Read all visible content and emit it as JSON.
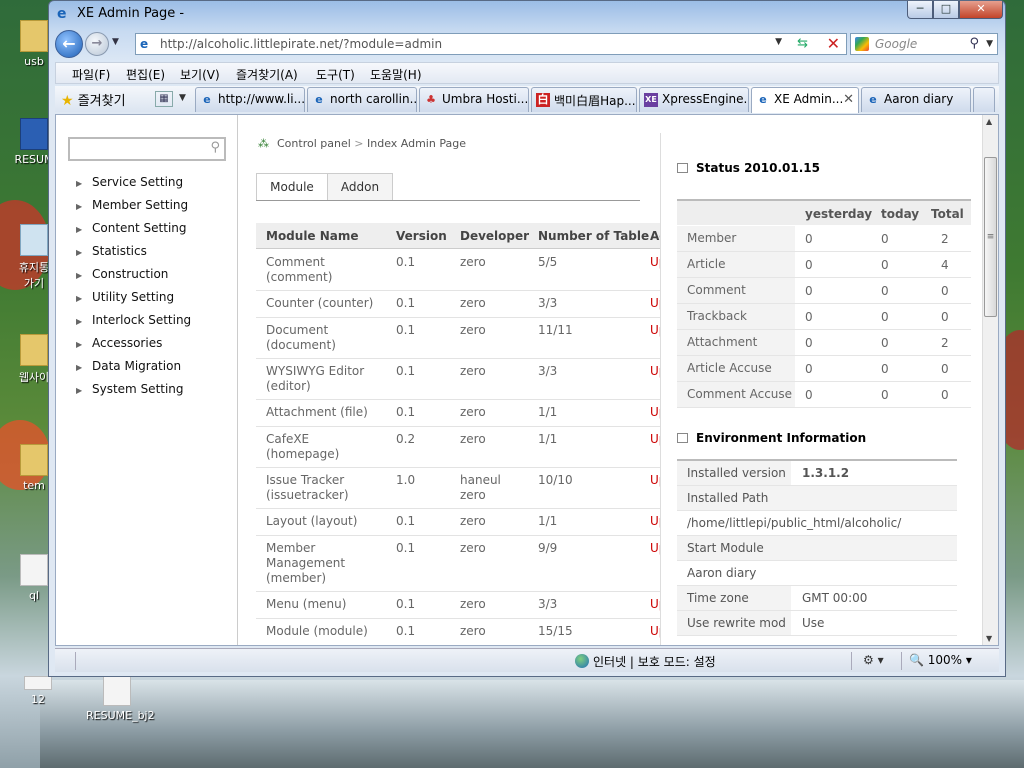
{
  "desktop": {
    "icons": [
      {
        "label": "usb",
        "icon": "folder-icon"
      },
      {
        "label": "RESUM",
        "icon": "word-doc-icon"
      },
      {
        "label": "휴지통\n가기",
        "icon": "recycle-bin-icon"
      },
      {
        "label": "웹사이",
        "icon": "folder-icon"
      },
      {
        "label": "tem",
        "icon": "folder-icon"
      },
      {
        "label": "ql",
        "icon": "file-icon"
      },
      {
        "label": "12",
        "icon": "file-icon"
      },
      {
        "label": "RESUME_bj2",
        "icon": "document-icon"
      }
    ]
  },
  "window": {
    "title": "XE Admin Page -",
    "controls": {
      "minimize": "─",
      "maximize": "□",
      "close": "✕"
    }
  },
  "nav": {
    "url": "http://alcoholic.littlepirate.net/?module=admin",
    "search_placeholder": "Google"
  },
  "menubar": {
    "items": [
      "파일(F)",
      "편집(E)",
      "보기(V)",
      "즐겨찾기(A)",
      "도구(T)",
      "도움말(H)"
    ]
  },
  "favorites": {
    "label": "즐겨찾기"
  },
  "tabs": [
    {
      "label": "http://www.li...",
      "icon": "ie-page-icon"
    },
    {
      "label": "north carollin...",
      "icon": "ie-page-icon"
    },
    {
      "label": "Umbra Hosti...",
      "icon": "umbra-icon"
    },
    {
      "label": "백미白眉Hap...",
      "icon": "baekmi-icon"
    },
    {
      "label": "XpressEngine...",
      "icon": "xe-icon"
    },
    {
      "label": "XE Admin...",
      "icon": "ie-page-icon",
      "active": true
    },
    {
      "label": "Aaron diary",
      "icon": "ie-page-icon"
    }
  ],
  "sidebar": {
    "search_placeholder": "",
    "items": [
      {
        "label": "Service Setting"
      },
      {
        "label": "Member Setting"
      },
      {
        "label": "Content Setting"
      },
      {
        "label": "Statistics"
      },
      {
        "label": "Construction"
      },
      {
        "label": "Utility Setting"
      },
      {
        "label": "Interlock Setting"
      },
      {
        "label": "Accessories"
      },
      {
        "label": "Data Migration"
      },
      {
        "label": "System Setting"
      }
    ]
  },
  "main": {
    "breadcrumb": {
      "root": "Control panel",
      "sep": ">",
      "current": "Index Admin Page"
    },
    "tabs": [
      {
        "label": "Module"
      },
      {
        "label": "Addon"
      }
    ],
    "module_table": {
      "headers": [
        "Module Name",
        "Version",
        "Developer",
        "Number of Table",
        "Actio"
      ],
      "rows": [
        {
          "name": "Comment\n(comment)",
          "version": "0.1",
          "developer": "zero",
          "tables": "5/5",
          "action": "Upda"
        },
        {
          "name": "Counter (counter)",
          "version": "0.1",
          "developer": "zero",
          "tables": "3/3",
          "action": "Upda"
        },
        {
          "name": "Document\n(document)",
          "version": "0.1",
          "developer": "zero",
          "tables": "11/11",
          "action": "Upda"
        },
        {
          "name": "WYSIWYG Editor\n(editor)",
          "version": "0.1",
          "developer": "zero",
          "tables": "3/3",
          "action": "Upda"
        },
        {
          "name": "Attachment (file)",
          "version": "0.1",
          "developer": "zero",
          "tables": "1/1",
          "action": "Update"
        },
        {
          "name": "CafeXE\n(homepage)",
          "version": "0.2",
          "developer": "zero",
          "tables": "1/1",
          "action": "Upda"
        },
        {
          "name": "Issue Tracker\n(issuetracker)",
          "version": "1.0",
          "developer": "haneul\nzero",
          "tables": "10/10",
          "action": "Upda"
        },
        {
          "name": "Layout (layout)",
          "version": "0.1",
          "developer": "zero",
          "tables": "1/1",
          "action": "Update"
        },
        {
          "name": "Member\nManagement\n(member)",
          "version": "0.1",
          "developer": "zero",
          "tables": "9/9",
          "action": "Upda"
        },
        {
          "name": "Menu (menu)",
          "version": "0.1",
          "developer": "zero",
          "tables": "3/3",
          "action": "Upda"
        },
        {
          "name": "Module (module)",
          "version": "0.1",
          "developer": "zero",
          "tables": "15/15",
          "action": "Upda"
        }
      ]
    }
  },
  "status": {
    "title": "Status 2010.01.15",
    "columns": [
      "yesterday",
      "today",
      "Total"
    ],
    "rows": [
      {
        "label": "Member",
        "yesterday": "0",
        "today": "0",
        "total": "2"
      },
      {
        "label": "Article",
        "yesterday": "0",
        "today": "0",
        "total": "4"
      },
      {
        "label": "Comment",
        "yesterday": "0",
        "today": "0",
        "total": "0"
      },
      {
        "label": "Trackback",
        "yesterday": "0",
        "today": "0",
        "total": "0"
      },
      {
        "label": "Attachment",
        "yesterday": "0",
        "today": "0",
        "total": "2"
      },
      {
        "label": "Article Accuse",
        "yesterday": "0",
        "today": "0",
        "total": "0"
      },
      {
        "label": "Comment Accuse",
        "yesterday": "0",
        "today": "0",
        "total": "0"
      }
    ]
  },
  "environment": {
    "title": "Environment Information",
    "rows": [
      {
        "label": "Installed version",
        "value": "1.3.1.2"
      },
      {
        "label": "Installed Path",
        "value": ""
      },
      {
        "label": "/home/littlepi/public_html/alcoholic/",
        "value": ""
      },
      {
        "label": "Start Module",
        "value": ""
      },
      {
        "label": "Aaron diary",
        "value": ""
      },
      {
        "label": "Time zone",
        "value": "GMT 00:00"
      },
      {
        "label": "Use rewrite mod",
        "value": "Use"
      }
    ]
  },
  "statusbar": {
    "zone": "인터넷 | 보호 모드: 설정",
    "zoom": "100%"
  }
}
